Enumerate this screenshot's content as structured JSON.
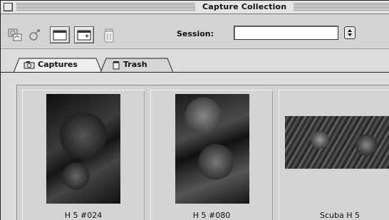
{
  "window": {
    "title": "Capture Collection"
  },
  "toolbar": {
    "buttons": [
      {
        "name": "capture-icon"
      },
      {
        "name": "link-icon"
      },
      {
        "name": "folder-icon"
      },
      {
        "name": "new-folder-icon"
      },
      {
        "name": "trash-can-icon"
      }
    ],
    "session_label": "Session:",
    "session_value": ""
  },
  "tabs": [
    {
      "label": "Captures",
      "icon": "camera-icon",
      "active": true
    },
    {
      "label": "Trash",
      "icon": "trash-can-icon",
      "active": false
    }
  ],
  "captures": [
    {
      "label": "H 5 #024",
      "orientation": "portrait"
    },
    {
      "label": "H 5 #080",
      "orientation": "portrait"
    },
    {
      "label": "Scuba H 5",
      "orientation": "landscape"
    }
  ]
}
